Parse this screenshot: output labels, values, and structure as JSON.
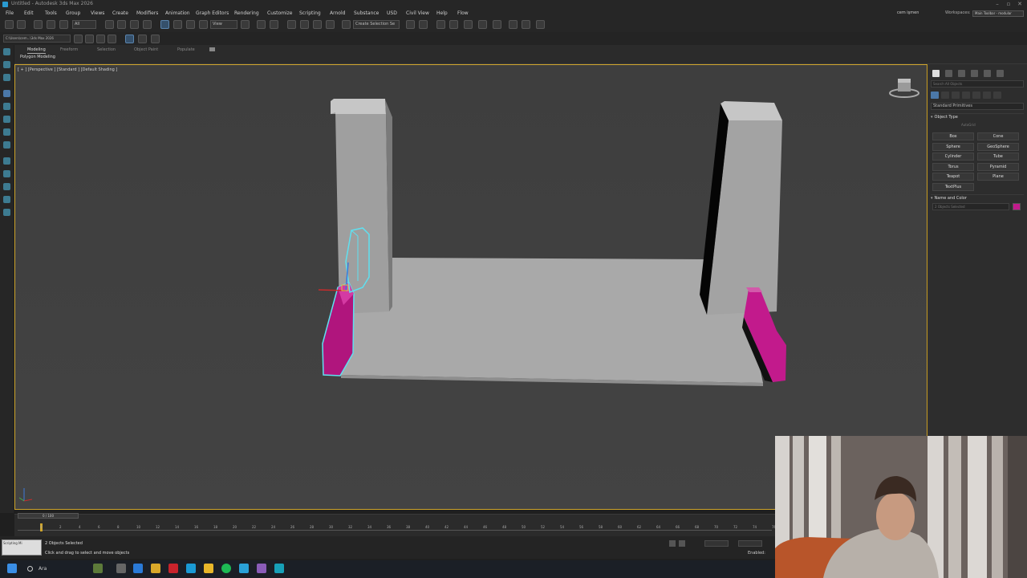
{
  "window": {
    "title": "Untitled - Autodesk 3ds Max 2026"
  },
  "menu": [
    "File",
    "Edit",
    "Tools",
    "Group",
    "Views",
    "Create",
    "Modifiers",
    "Animation",
    "Graph Editors",
    "Rendering",
    "Customize",
    "Scripting",
    "Arnold",
    "Substance",
    "USD",
    "Civil View",
    "Help",
    "Flow"
  ],
  "account": {
    "user": "cem işmen",
    "workspaces_label": "Workspaces:",
    "workspace": "Main Toolbar - modular"
  },
  "toolbar": {
    "filter_value": "All",
    "view_value": "View",
    "selection_set_placeholder": "Create Selection Se",
    "project_path": "C:\\Users\\cem...\\3ds Max 2026"
  },
  "ribbon": {
    "tabs": [
      "Modeling",
      "Freeform",
      "Selection",
      "Object Paint",
      "Populate"
    ],
    "panel_label": "Polygon Modeling"
  },
  "viewport": {
    "label": "[ + ] [Perspective ] [Standard ] [Default Shading ]"
  },
  "command_panel": {
    "search_placeholder": "Search All Objects",
    "category": "Standard Primitives",
    "object_type_title": "Object Type",
    "autogrid": "AutoGrid",
    "primitives": [
      "Box",
      "Cone",
      "Sphere",
      "GeoSphere",
      "Cylinder",
      "Tube",
      "Torus",
      "Pyramid",
      "Teapot",
      "Plane",
      "TextPlus"
    ],
    "name_color_title": "Name and Color",
    "name_value": "2 Objects Selected",
    "object_color": "#c21a8c"
  },
  "timeline": {
    "slider_label": "0 / 100",
    "ticks": [
      "0",
      "2",
      "4",
      "6",
      "8",
      "10",
      "12",
      "14",
      "16",
      "18",
      "20",
      "22",
      "24",
      "26",
      "28",
      "30",
      "32",
      "34",
      "36",
      "38",
      "40",
      "42",
      "44",
      "46",
      "48",
      "50",
      "52",
      "54",
      "56",
      "58",
      "60",
      "62",
      "64",
      "66",
      "68",
      "70",
      "72",
      "74",
      "76"
    ]
  },
  "status": {
    "selection": "2 Objects Selected",
    "prompt": "Click and drag to select and move objects",
    "maxscript_label": "Scripting Mi",
    "enabled_label": "Enabled:"
  },
  "taskbar": {
    "search_label": "Ara"
  },
  "colors": {
    "accent": "#cfa52c",
    "selection": "#5fe0f0",
    "magenta": "#c21a8c"
  }
}
